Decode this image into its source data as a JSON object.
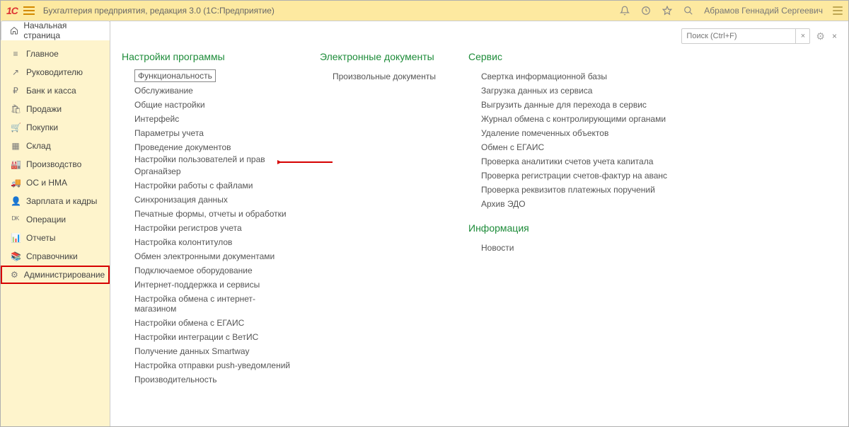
{
  "topbar": {
    "title": "Бухгалтерия предприятия, редакция 3.0  (1С:Предприятие)",
    "user": "Абрамов Геннадий Сергеевич"
  },
  "tab_home": "Начальная страница",
  "sidebar": {
    "items": [
      {
        "icon": "≡",
        "label": "Главное"
      },
      {
        "icon": "↗",
        "label": "Руководителю"
      },
      {
        "icon": "₽",
        "label": "Банк и касса"
      },
      {
        "icon": "🛍",
        "label": "Продажи"
      },
      {
        "icon": "🛒",
        "label": "Покупки"
      },
      {
        "icon": "▦",
        "label": "Склад"
      },
      {
        "icon": "🏭",
        "label": "Производство"
      },
      {
        "icon": "🚚",
        "label": "ОС и НМА"
      },
      {
        "icon": "👤",
        "label": "Зарплата и кадры"
      },
      {
        "icon": "ᴰᴷ",
        "label": "Операции"
      },
      {
        "icon": "📊",
        "label": "Отчеты"
      },
      {
        "icon": "📚",
        "label": "Справочники"
      },
      {
        "icon": "⚙",
        "label": "Администрирование"
      }
    ],
    "active_index": 12
  },
  "search": {
    "placeholder": "Поиск (Ctrl+F)"
  },
  "columns": {
    "settings": {
      "title": "Настройки программы",
      "items": [
        "Функциональность",
        "Обслуживание",
        "Общие настройки",
        "Интерфейс",
        "Параметры учета",
        "Проведение документов",
        "Настройки пользователей и прав",
        "Органайзер",
        "Настройки работы с файлами",
        "Синхронизация данных",
        "Печатные формы, отчеты и обработки",
        "Настройки регистров учета",
        "Настройка колонтитулов",
        "Обмен электронными документами",
        "Подключаемое оборудование",
        "Интернет-поддержка и сервисы",
        "Настройка обмена с интернет-магазином",
        "Настройки обмена с ЕГАИС",
        "Настройки интеграции с ВетИС",
        "Получение данных Smartway",
        "Настройка отправки push-уведомлений",
        "Производительность"
      ]
    },
    "edocs": {
      "title": "Электронные документы",
      "items": [
        "Произвольные документы"
      ]
    },
    "service": {
      "title": "Сервис",
      "items": [
        "Свертка информационной базы",
        "Загрузка данных из сервиса",
        "Выгрузить данные для перехода в сервис",
        "Журнал обмена с контролирующими органами",
        "Удаление помеченных объектов",
        "Обмен с ЕГАИС",
        "Проверка аналитики счетов учета капитала",
        "Проверка регистрации счетов-фактур на аванс",
        "Проверка реквизитов платежных поручений",
        "Архив ЭДО"
      ]
    },
    "info": {
      "title": "Информация",
      "items": [
        "Новости"
      ]
    }
  }
}
